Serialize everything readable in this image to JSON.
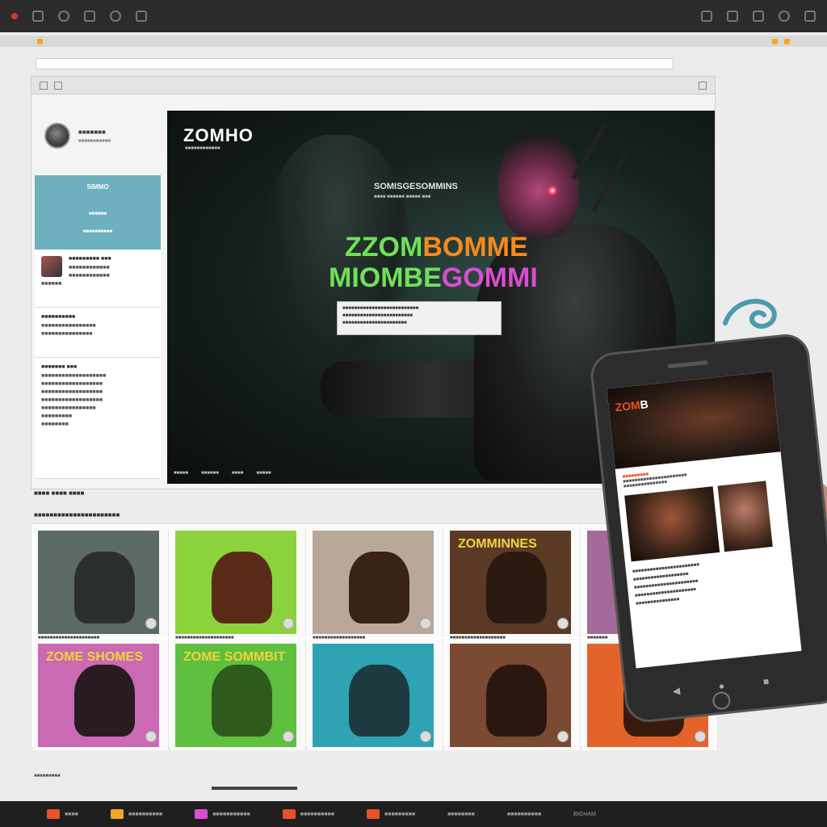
{
  "brand": "ZOMHO",
  "brand_sub": "■■■■■■■■■■■■",
  "tagline": "SOMISGESOMMINS",
  "tagline_sub": "■■■■ ■■■■■■ ■■■■■ ■■■",
  "hero_title_line1_a": "ZZOM",
  "hero_title_line1_b": "BOMME",
  "hero_title_line2_a": "MIOMBE",
  "hero_title_line2_b": "GOMMI",
  "hero_info": [
    "■■■■■■■■■■■■■■■■■■■■■■■■■■",
    "■■■■■■■■■■■■■■■■■■■■■■■■",
    "■■■■■■■■■■■■■■■■■■■■■■"
  ],
  "hero_nav": [
    "■■■■■",
    "■■■■■■",
    "■■■■",
    "■■■■■"
  ],
  "sidebar": {
    "profile_name": "■■■■■■■",
    "profile_sub": "■■■■■■■■■■■",
    "teal_title": "SIMMO",
    "teal_sub1": "■■■■■■",
    "teal_sub2": "■■■■■■■■■■",
    "block1_title": "■■■■■■■■■ ■■■",
    "block1_lines": [
      "■■■■■■■■■■■■",
      "■■■■■■■■■■■■",
      "■■■■■■"
    ],
    "block2_title": "■■■■■■■■■■",
    "block2_lines": [
      "■■■■■■■■■■■■■■■■",
      "■■■■■■■■■■■■■■■"
    ],
    "block3_title": "■■■■■■■ ■■■",
    "block3_lines": [
      "■■■■■■■■■■■■■■■■■■■",
      "■■■■■■■■■■■■■■■■■■",
      "■■■■■■■■■■■■■■■■■■",
      "■■■■■■■■■■■■■■■■■■",
      "■■■■■■■■■■■■■■■■",
      "■■■■■■■■■",
      "■■■■■■■■"
    ]
  },
  "section_label_1": "■■■■ ■■■■ ■■■■",
  "section_label_2": "■■■■■■■■■■■■■■■■■■■■■■",
  "cards": [
    {
      "title": "",
      "caption": [
        "■■■■■■■■■■■■■■■■■■■■■",
        "■■■■■■■■■■"
      ],
      "bg": "#5b6a66",
      "fig": "#2a2f2d"
    },
    {
      "title": "",
      "caption": [
        "■■■■■■■■■■■■■■■■■■■■",
        "■■■■■■■■■■■■■■■"
      ],
      "bg": "#8bd23c",
      "fig": "#5a2a18"
    },
    {
      "title": "",
      "caption": [
        "■■■■■■■■■■■■■■■■■■",
        "■■■■■■■"
      ],
      "bg": "#b9a89a",
      "fig": "#3a2218"
    },
    {
      "title": "ZOMMINNES",
      "caption": [
        "■■■■■■■■■■■■■■■■■■■",
        "■■■■■■■"
      ],
      "bg": "#5b3a25",
      "fig": "#2a1a10"
    },
    {
      "title": "",
      "caption": [
        "■■■■■■■",
        "■■■■■■■"
      ],
      "bg": "#a46a9a",
      "fig": "#4a2a40"
    },
    {
      "title": "ZOME SHOMES",
      "caption": [],
      "bg": "#c96ab2",
      "fig": "#2a1a22"
    },
    {
      "title": "ZOME SOMMBIT",
      "caption": [],
      "bg": "#5fbf3e",
      "fig": "#2f5a1e"
    },
    {
      "title": "",
      "caption": [],
      "bg": "#2fa3b3",
      "fig": "#1c3a40"
    },
    {
      "title": "",
      "caption": [],
      "bg": "#7a4a32",
      "fig": "#2a1810"
    },
    {
      "title": "",
      "caption": [],
      "bg": "#e4632a",
      "fig": "#3a1a0c"
    }
  ],
  "grid_footer": "■■■■■■■■■",
  "phone": {
    "logo_a": "ZOM",
    "logo_b": "B",
    "section_title": "■■■■■■■■■",
    "section_lines": [
      "■■■■■■■■■■■■■■■■■■■■■■",
      "■■■■■■■■■■■■■■■"
    ],
    "list": [
      "■■■■■■■■■■■■■■■■■■■■■■■",
      "■■■■■■■■■■■■■■■■■■■",
      "■■■■■■■■■■■■■■■■■■■■■■",
      "■■■■■■■■■■■■■■■■■■■■■",
      "■■■■■■■■■■■■■■■"
    ]
  },
  "taskbar_items": [
    "■■■■",
    "■■■■■■■■■■",
    "■■■■■■■■■■■",
    "■■■■■■■■■■",
    "■■■■■■■■■",
    "■■■■■■■■",
    "■■■■■■■■■■",
    "BIGHAM"
  ],
  "taskbar_colors": [
    "#e8512b",
    "#f5a623",
    "#d94ed0",
    "#e8512b",
    "#e8512b"
  ]
}
